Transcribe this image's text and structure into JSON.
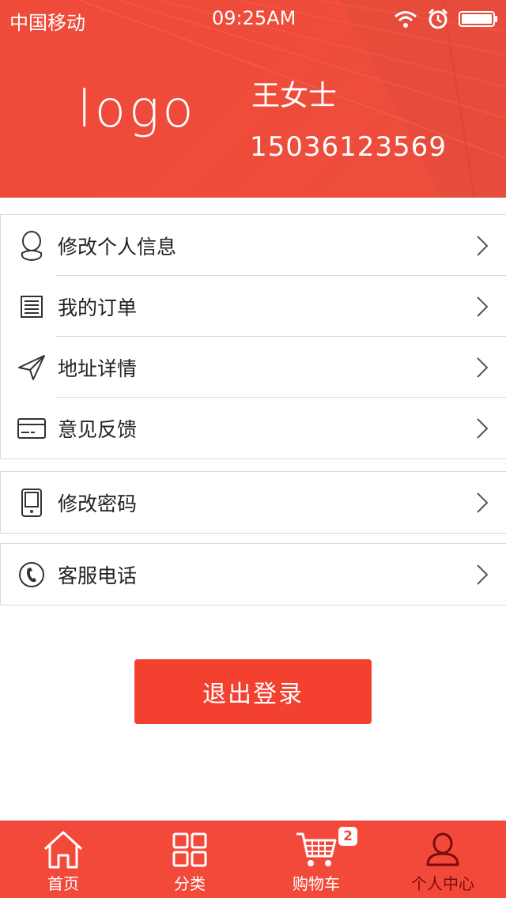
{
  "status_bar": {
    "carrier": "中国移动",
    "time": "09:25AM"
  },
  "profile": {
    "logo": "logo",
    "name": "王女士",
    "phone": "15036123569"
  },
  "menu": {
    "group1": [
      {
        "label": "修改个人信息",
        "icon": "person-outline-icon"
      },
      {
        "label": "我的订单",
        "icon": "order-list-icon"
      },
      {
        "label": "地址详情",
        "icon": "paper-plane-icon"
      },
      {
        "label": "意见反馈",
        "icon": "card-icon"
      }
    ],
    "group2": [
      {
        "label": "修改密码",
        "icon": "phone-device-icon"
      }
    ],
    "group3": [
      {
        "label": "客服电话",
        "icon": "telephone-icon"
      }
    ]
  },
  "logout_label": "退出登录",
  "tabbar": {
    "items": [
      {
        "label": "首页",
        "icon": "home-icon"
      },
      {
        "label": "分类",
        "icon": "grid-icon"
      },
      {
        "label": "购物车",
        "icon": "cart-icon"
      },
      {
        "label": "个人中心",
        "icon": "user-icon"
      }
    ],
    "cart_badge": "2",
    "active_index": 3
  },
  "colors": {
    "accent": "#f3493a",
    "active_tab_text": "#7a0d0a"
  }
}
